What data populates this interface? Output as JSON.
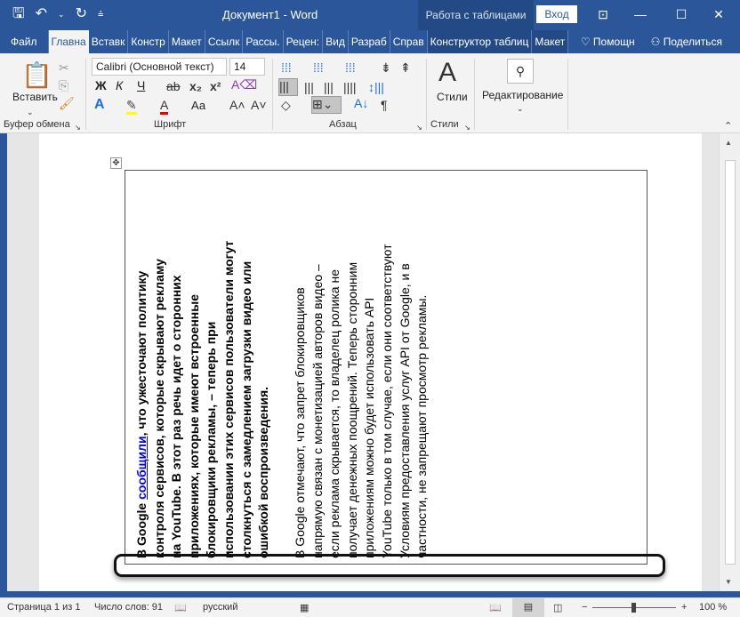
{
  "titlebar": {
    "title": "Документ1 - Word",
    "context_group": "Работа с таблицами",
    "login_label": "Вход",
    "qat_icons": [
      "save-icon",
      "undo-icon",
      "redo-icon",
      "customize-icon"
    ]
  },
  "tabs": [
    {
      "label": "Файл"
    },
    {
      "label": "Главная",
      "active": true
    },
    {
      "label": "Вставка"
    },
    {
      "label": "Конструктор"
    },
    {
      "label": "Макет"
    },
    {
      "label": "Ссылки"
    },
    {
      "label": "Рассылки"
    },
    {
      "label": "Рецензирование"
    },
    {
      "label": "Вид"
    },
    {
      "label": "Разработчик"
    },
    {
      "label": "Справка"
    },
    {
      "label": "Конструктор таблиц",
      "context": true
    },
    {
      "label": "Макет",
      "context": true
    }
  ],
  "tab_display": [
    "Файл",
    "Главна",
    "Вставк",
    "Констр",
    "Макет",
    "Ссылк",
    "Рассы.",
    "Рецен:",
    "Вид",
    "Разраб",
    "Справ",
    "Конструктор таблиц",
    "Макет"
  ],
  "tabs_right": {
    "help": "Помощн",
    "share": "Поделиться"
  },
  "ribbon": {
    "clipboard": {
      "paste": "Вставить",
      "label": "Буфер обмена"
    },
    "font": {
      "name": "Calibri (Основной текст)",
      "size": "14",
      "bold": "Ж",
      "italic": "К",
      "underline": "Ч",
      "label": "Шрифт",
      "case": "Аа"
    },
    "paragraph": {
      "label": "Абзац"
    },
    "styles": {
      "button": "Стили",
      "label": "Стили"
    },
    "editing": {
      "button": "Редактирование"
    }
  },
  "document": {
    "col1": [
      {
        "pre": "В Google ",
        "link": "сообщили",
        "post": ", что ужесточают политику"
      },
      {
        "text": "контроля сервисов, которые скрывают рекламу"
      },
      {
        "text": "на YouTube. В этот раз речь идет о сторонних"
      },
      {
        "text": "приложениях, которые имеют встроенные"
      },
      {
        "text": "блокировщики рекламы, – теперь при"
      },
      {
        "text": "использовании этих сервисов пользователи могут"
      },
      {
        "text": "столкнуться с замедлением загрузки видео или"
      },
      {
        "text": "ошибкой воспроизведения."
      }
    ],
    "col2": [
      "В Google отмечают, что запрет блокировщиков",
      "напрямую связан с монетизацией авторов видео –",
      "если реклама скрывается, то владелец ролика не",
      "получает денежных поощрений. Теперь сторонним",
      "приложениям можно будет использовать API",
      "YouTube только в том случае, если они соответствуют",
      "Условиям предоставления услуг API от Google, и в",
      "частности, не запрещают просмотр рекламы."
    ]
  },
  "status": {
    "page": "Страница 1 из 1",
    "words": "Число слов: 91",
    "language": "русский",
    "zoom": "100 %",
    "zoom_level_percent": 100
  }
}
